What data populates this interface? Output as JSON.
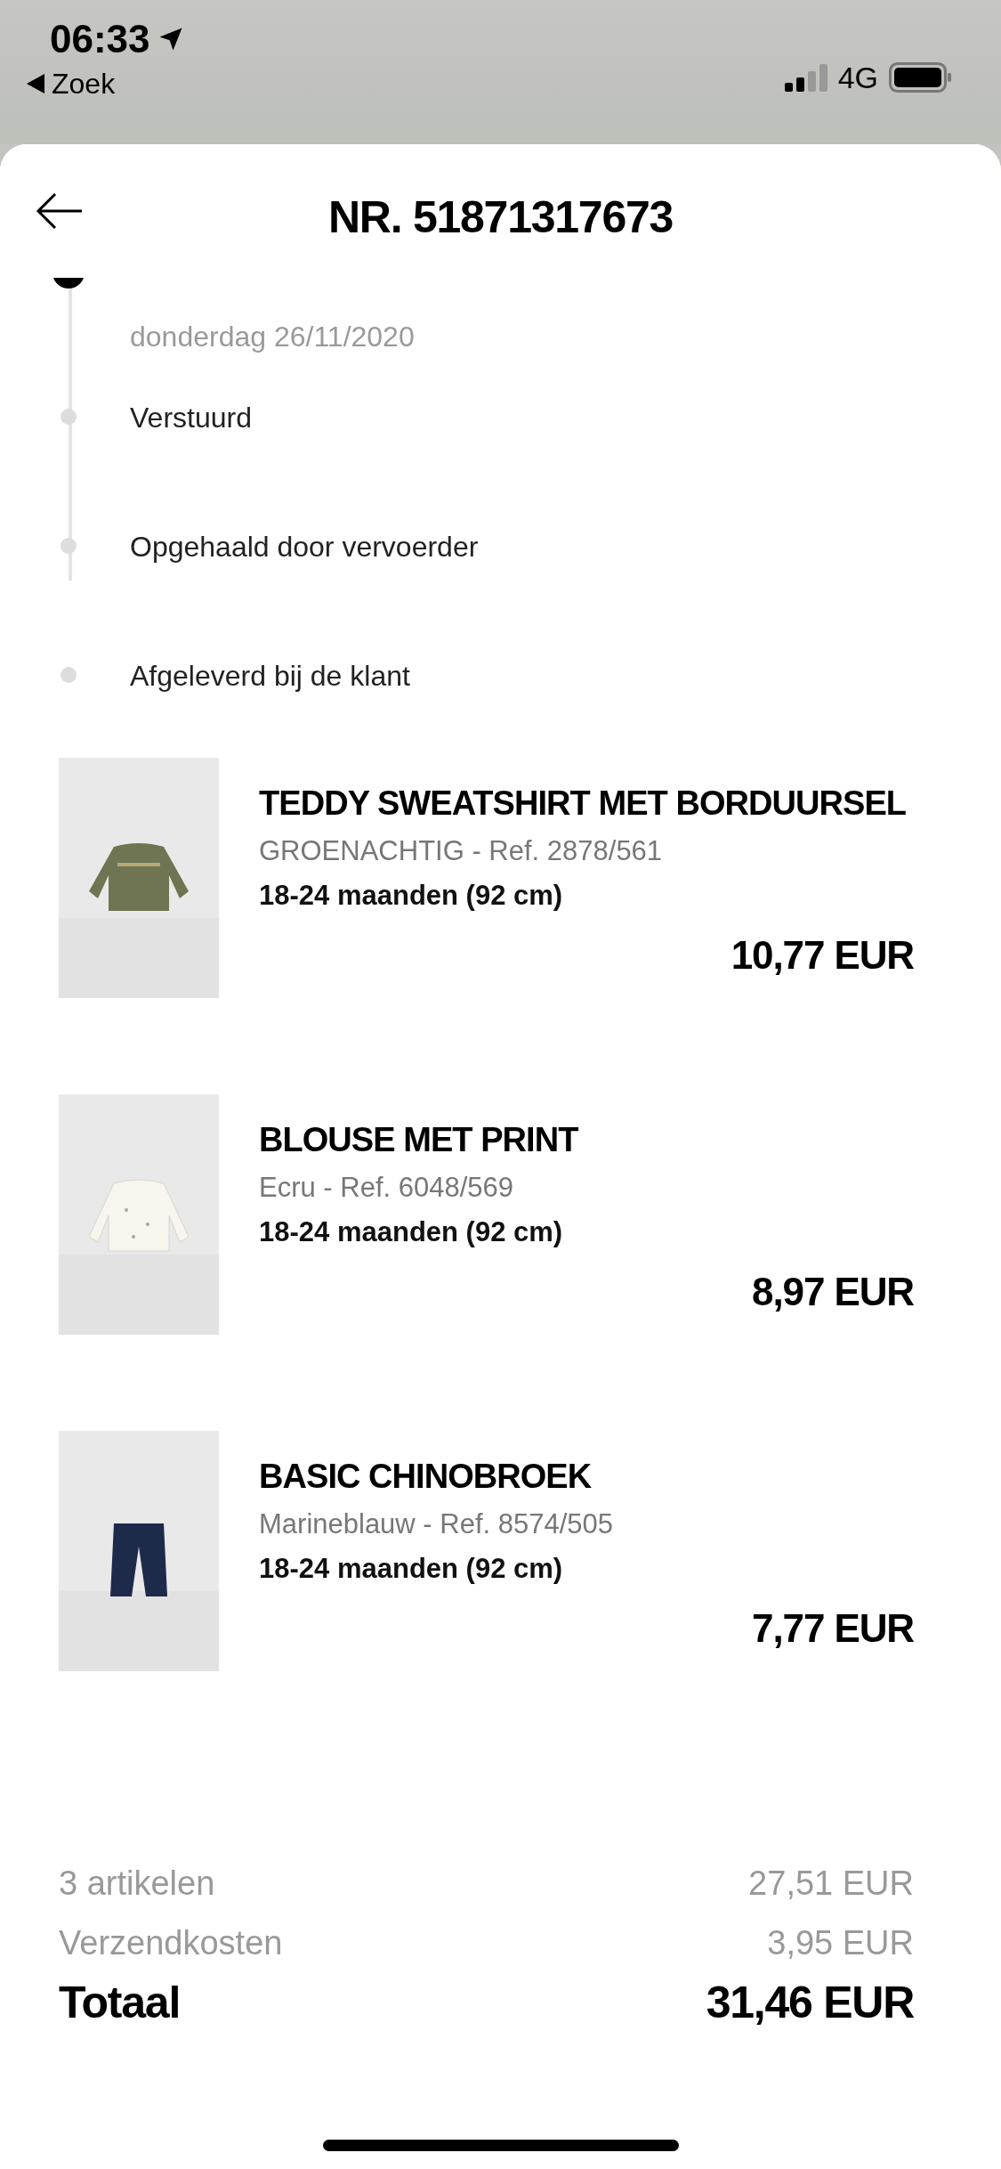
{
  "status_bar": {
    "time": "06:33",
    "back_label": "Zoek",
    "network": "4G"
  },
  "header": {
    "title": "NR. 51871317673"
  },
  "timeline": [
    {
      "date": "donderdag 26/11/2020",
      "done": true
    },
    {
      "label": "Verstuurd",
      "done": false
    },
    {
      "label": "Opgehaald door vervoerder",
      "done": false
    },
    {
      "label": "Afgeleverd bij de klant",
      "done": false
    }
  ],
  "items": [
    {
      "name": "TEDDY SWEATSHIRT MET BORDUURSEL",
      "variant": "GROENACHTIG - Ref. 2878/561",
      "size": "18-24 maanden (92 cm)",
      "price": "10,77 EUR"
    },
    {
      "name": "BLOUSE MET PRINT",
      "variant": "Ecru - Ref. 6048/569",
      "size": "18-24 maanden (92 cm)",
      "price": "8,97 EUR"
    },
    {
      "name": "BASIC CHINOBROEK",
      "variant": "Marineblauw - Ref. 8574/505",
      "size": "18-24 maanden (92 cm)",
      "price": "7,77 EUR"
    }
  ],
  "summary": [
    {
      "label": "3 artikelen",
      "value": "27,51 EUR"
    },
    {
      "label": "Verzendkosten",
      "value": "3,95 EUR"
    }
  ],
  "total": {
    "label": "Totaal",
    "value": "31,46 EUR"
  }
}
